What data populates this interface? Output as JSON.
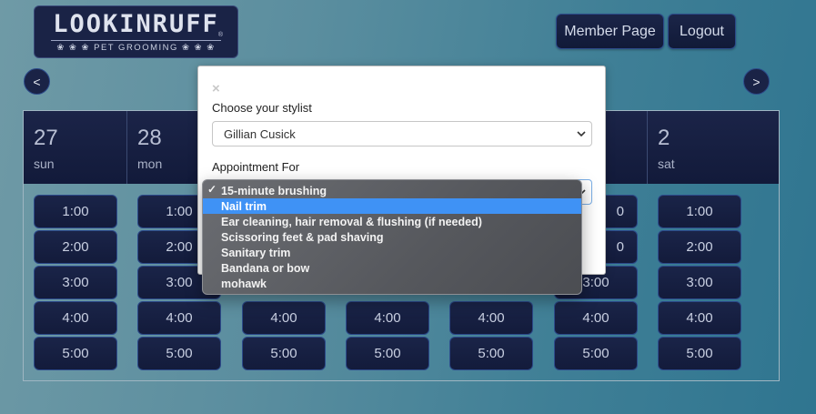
{
  "logo": {
    "text": "LOOKINRUFF",
    "mark": "®",
    "subtitle": "❀ ❀ ❀ PET GROOMING ❀ ❀ ❀"
  },
  "header": {
    "member_label": "Member Page",
    "logout_label": "Logout"
  },
  "nav": {
    "prev": "<",
    "next": ">"
  },
  "days": [
    {
      "num": "27",
      "weekday": "sun"
    },
    {
      "num": "28",
      "weekday": "mon"
    },
    {
      "num": "2",
      "weekday": "sat"
    }
  ],
  "columns": [
    {
      "times": [
        "1:00",
        "2:00",
        "3:00",
        "4:00",
        "5:00"
      ]
    },
    {
      "times": [
        "1:00",
        "2:00",
        "3:00",
        "4:00",
        "5:00"
      ]
    },
    {
      "times": [
        "4:00",
        "5:00"
      ]
    },
    {
      "times": [
        "4:00",
        "5:00"
      ]
    },
    {
      "times": [
        "4:00",
        "5:00"
      ]
    },
    {
      "times": [
        "0",
        "0",
        "3:00",
        "4:00",
        "5:00"
      ]
    },
    {
      "times": [
        "1:00",
        "2:00",
        "3:00",
        "4:00",
        "5:00"
      ]
    }
  ],
  "modal": {
    "close": "×",
    "stylist_label": "Choose your stylist",
    "stylist_value": "Gillian Cusick",
    "appointment_label": "Appointment For"
  },
  "dropdown": {
    "selected_index": 0,
    "highlighted_index": 1,
    "options": [
      "15-minute brushing",
      "Nail trim",
      "Ear cleaning, hair removal & flushing (if needed)",
      "Scissoring feet & pad shaving",
      "Sanitary trim",
      "Bandana or bow",
      "mohawk"
    ]
  },
  "icons": {
    "chevron": "chevron-down-icon",
    "check": "checkmark-icon",
    "close": "close-icon"
  },
  "colors": {
    "navy": "#1a2346",
    "accent_blue": "#3f92f5",
    "border_blue": "#2c4a8a"
  }
}
